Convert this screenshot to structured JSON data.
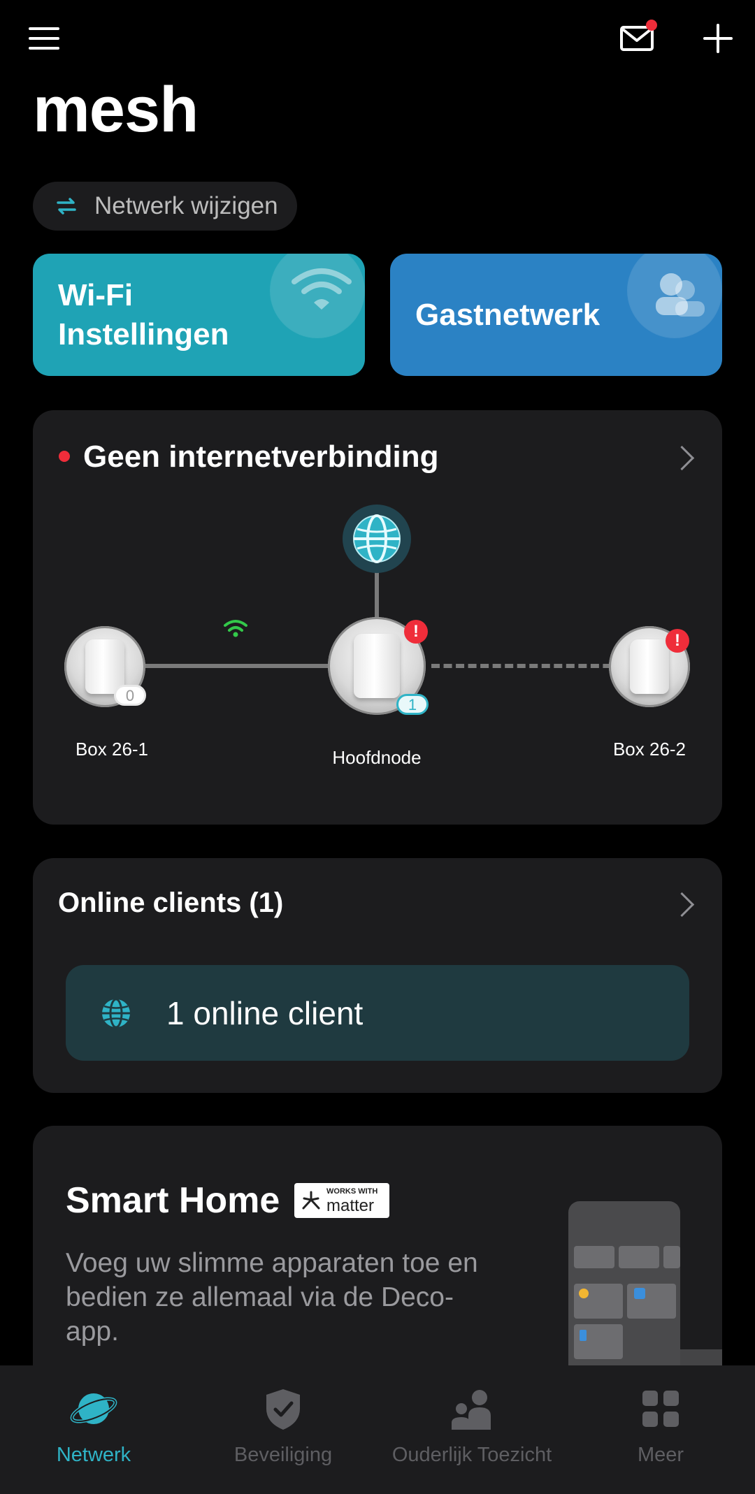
{
  "header": {
    "title": "mesh",
    "menu_icon": "hamburger-menu-icon",
    "mail_icon": "mail-icon",
    "add_icon": "plus-icon",
    "notification_color": "#ef2d3a"
  },
  "network_switch": {
    "label": "Netwerk wijzigen",
    "icon": "swap-arrows-icon"
  },
  "tiles": {
    "wifi": {
      "label_line1": "Wi-Fi",
      "label_line2": "Instellingen",
      "color": "#1fa3b5",
      "icon": "wifi-icon"
    },
    "guest": {
      "label": "Gastnetwerk",
      "color": "#2b82c4",
      "icon": "users-icon"
    }
  },
  "topology": {
    "status": "Geen internetverbinding",
    "status_color": "#ef2d3a",
    "internet_icon": "globe-icon",
    "nodes": [
      {
        "label": "Box 26-1",
        "clients": "0",
        "warning": false
      },
      {
        "label": "Hoofdnode",
        "clients": "1",
        "warning": true
      },
      {
        "label": "Box 26-2",
        "clients": "",
        "warning": true
      }
    ],
    "warning_glyph": "!"
  },
  "clients": {
    "title": "Online clients (1)",
    "summary": "1 online client",
    "icon": "globe-icon"
  },
  "smart_home": {
    "title": "Smart Home",
    "badge_small": "WORKS WITH",
    "badge_big": "matter",
    "description": "Voeg uw slimme apparaten toe en bedien ze allemaal via de Deco-app."
  },
  "bottom_nav": {
    "items": [
      {
        "label": "Netwerk",
        "icon": "planet-icon",
        "active": true
      },
      {
        "label": "Beveiliging",
        "icon": "shield-check-icon",
        "active": false
      },
      {
        "label": "Ouderlijk Toezicht",
        "icon": "parent-child-icon",
        "active": false
      },
      {
        "label": "Meer",
        "icon": "grid-icon",
        "active": false
      }
    ],
    "active_color": "#2fb3c6",
    "inactive_color": "#5e5e62"
  }
}
